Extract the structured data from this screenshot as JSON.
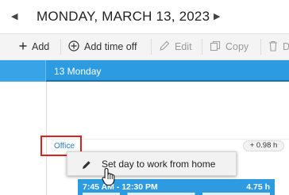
{
  "header": {
    "date_title": "MONDAY, MARCH 13, 2023",
    "prev_glyph": "◀",
    "next_glyph": "▶"
  },
  "toolbar": {
    "add_label": "Add",
    "add_time_off_label": "Add time off",
    "edit_label": "Edit",
    "copy_label": "Copy",
    "delete_label": "D"
  },
  "day_column": {
    "label": "13 Monday"
  },
  "cell": {
    "office_tag": "Office",
    "hours_badge": "+ 0.98 h"
  },
  "context_menu": {
    "item_label": "Set day to work from home",
    "item_icon": "pencil-icon"
  },
  "shift": {
    "time_range": "7:45 AM - 12:30 PM",
    "hours": "4.75 h"
  },
  "colors": {
    "accent_blue": "#2d9be2",
    "header_underline": "#1e6fa8",
    "highlight_red": "#e0201b",
    "office_link": "#2b7fc4"
  }
}
